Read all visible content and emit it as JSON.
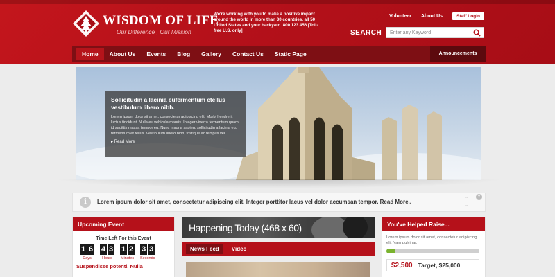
{
  "brand": {
    "name": "WISDOM OF LIFE",
    "tagline": "Our Difference , Our Mission"
  },
  "header": {
    "blurb": "We're working with you to make a positive impact around the world in more than 30 countries, all 50 United States and your backyard. 800.123.456 [Toll-free U.S. only]",
    "links": {
      "volunteer": "Volunteer",
      "about": "About Us",
      "staff": "Staff Login"
    },
    "search": {
      "label": "SEARCH",
      "placeholder": "Enter any Keyword"
    }
  },
  "nav": {
    "items": [
      "Home",
      "About Us",
      "Events",
      "Blog",
      "Gallery",
      "Contact Us",
      "Static Page"
    ],
    "announcements": "Announcements"
  },
  "hero": {
    "title": "Sollicitudin a lacinia eufermentum etellus vestibulum libero nibh.",
    "text": "Lorem ipsum dolor sit amet, consectetur adipiscing elit. Morbi hendrerit luctus tincidunt. Nulla eu vehicula mauris. Integer viverra fermentum quam, id sagittis massa tempor eu. Nunc magna sapien, sollicitudin a lacinia eu, fermentum et tellus. Vestibulum libero nibh, tristique ac tempus vel.",
    "more": "Read More"
  },
  "ticker": {
    "text": "Lorem ipsum dolor sit amet, consectetur adipiscing elit. Integer porttitor lacus vel dolor accumsan tempor. Read More..",
    "info_glyph": "i",
    "close_glyph": "×",
    "up_glyph": "⌃",
    "down_glyph": "⌄"
  },
  "event": {
    "heading": "Upcoming Event",
    "subheading": "Time Left For this Event",
    "countdown": [
      {
        "digits": [
          "1",
          "6"
        ],
        "label": "Days"
      },
      {
        "digits": [
          "4",
          "3"
        ],
        "label": "Hours"
      },
      {
        "digits": [
          "1",
          "2"
        ],
        "label": "Minutes"
      },
      {
        "digits": [
          "3",
          "3"
        ],
        "label": "Seconds"
      }
    ],
    "title": "Suspendisse potenti. Nulla"
  },
  "center": {
    "banner": "Happening Today (468 x 60)",
    "tabs": [
      "News Feed",
      "Video"
    ]
  },
  "raise": {
    "heading": "You've Helped Raise...",
    "text": "Lorem ipsum dolor sit amet, consectetur adipiscing elit Nam pulvinar.",
    "progress": 0.1,
    "amount": "$2,500",
    "target": "Target, $25,000"
  },
  "colors": {
    "brand_red": "#b5111a",
    "nav_dark": "#7e0f14",
    "progress_green": "#7ab32e"
  }
}
